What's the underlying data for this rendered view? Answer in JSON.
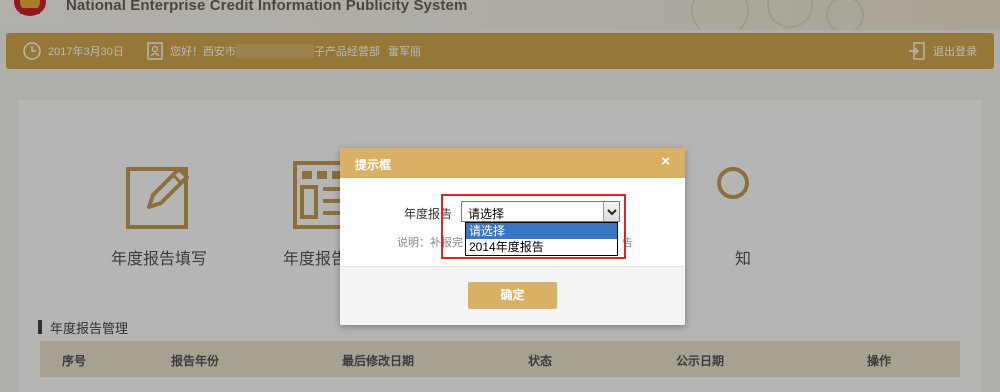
{
  "header": {
    "system_title": "National Enterprise Credit Information Publicity System"
  },
  "user_bar": {
    "date": "2017年3月30日",
    "greeting_prefix": "您好！西安市",
    "greeting_suffix": "子产品经营部",
    "user_name": "雷军丽",
    "logout_label": "退出登录"
  },
  "nav_tiles": [
    {
      "label": "年度报告填写",
      "icon": "pencil-edit-icon"
    },
    {
      "label": "年度报告模",
      "icon": "template-grid-icon"
    },
    {
      "label": "知",
      "icon": "notice-icon"
    }
  ],
  "section": {
    "title": "年度报告管理"
  },
  "table": {
    "columns": [
      "序号",
      "报告年份",
      "最后修改日期",
      "状态",
      "公示日期",
      "操作"
    ]
  },
  "modal": {
    "title": "提示框",
    "close_symbol": "×",
    "field_label": "年度报告",
    "select_value": "请选择",
    "options": [
      "请选择",
      "2014年度报告"
    ],
    "selected_index": 0,
    "note": "说明：补报完",
    "note_tail": "告",
    "confirm_label": "确定"
  },
  "colors": {
    "accent": "#cfa64e",
    "modal_header": "#d8b066",
    "highlight": "#e02424",
    "selected_option": "#3a75c4"
  }
}
